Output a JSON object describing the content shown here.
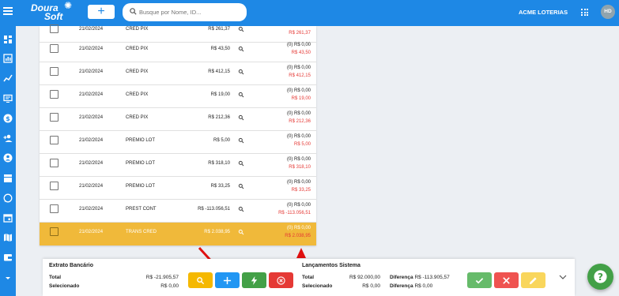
{
  "header": {
    "logo_line1": "Doura",
    "logo_line2": "Soft",
    "add_icon": "plus-icon",
    "search_placeholder": "Busque por Nome, ID...",
    "company": "ACME LOTERIAS",
    "avatar_initials": "HD"
  },
  "sidebar": {
    "icons": [
      "dashboard-icon",
      "bar-chart-icon",
      "trend-icon",
      "monitor-icon",
      "dollar-icon",
      "add-user-icon",
      "account-icon",
      "archive-icon",
      "whatsapp-icon",
      "calendar-icon",
      "map-icon",
      "wallet-icon",
      "chevron-down-icon"
    ]
  },
  "rows": [
    {
      "date": "21/02/2024",
      "desc": "CRED PIX",
      "value": "R$ 261,37",
      "info1": "",
      "info2": "R$ 261,37"
    },
    {
      "date": "21/02/2024",
      "desc": "CRED PIX",
      "value": "R$ 43,50",
      "info1": "(0) R$ 0,00",
      "info2": "R$ 43,50"
    },
    {
      "date": "21/02/2024",
      "desc": "CRED PIX",
      "value": "R$ 412,15",
      "info1": "(0) R$ 0,00",
      "info2": "R$ 412,15"
    },
    {
      "date": "21/02/2024",
      "desc": "CRED PIX",
      "value": "R$ 19,00",
      "info1": "(0) R$ 0,00",
      "info2": "R$ 19,00"
    },
    {
      "date": "21/02/2024",
      "desc": "CRED PIX",
      "value": "R$ 212,36",
      "info1": "(0) R$ 0,00",
      "info2": "R$ 212,36"
    },
    {
      "date": "21/02/2024",
      "desc": "PREMIO LOT",
      "value": "R$ 5,00",
      "info1": "(0) R$ 0,00",
      "info2": "R$ 5,00"
    },
    {
      "date": "21/02/2024",
      "desc": "PREMIO LOT",
      "value": "R$ 318,10",
      "info1": "(0) R$ 0,00",
      "info2": "R$ 318,10"
    },
    {
      "date": "21/02/2024",
      "desc": "PREMIO LOT",
      "value": "R$ 33,25",
      "info1": "(0) R$ 0,00",
      "info2": "R$ 33,25"
    },
    {
      "date": "21/02/2024",
      "desc": "PREST CONT",
      "value": "R$ -113.056,51",
      "info1": "(0) R$ 0,00",
      "info2": "R$ -113.056,51"
    },
    {
      "date": "21/02/2024",
      "desc": "TRANS CRED",
      "value": "R$ 2.038,95",
      "info1": "(0) R$ 0,00",
      "info2": "R$ 2.038,95"
    }
  ],
  "footer": {
    "left": {
      "title": "Extrato Bancário",
      "total_label": "Total",
      "total_value": "R$ -21.905,57",
      "selected_label": "Selecionado",
      "selected_value": "R$ 0,00"
    },
    "right": {
      "title": "Lançamentos Sistema",
      "total_label": "Total",
      "total_value": "R$ 92.000,00",
      "selected_label": "Selecionado",
      "selected_value": "R$ 0,00",
      "diff_label": "Diferença",
      "diff_value": "R$ -113.905,57",
      "diff2_label": "Diferença",
      "diff2_value": "R$ 0,00"
    }
  },
  "colors": {
    "primary": "#1e88e5",
    "highlight_row": "#f0b93a",
    "negative": "#e53935",
    "btn_yellow": "#f5b800",
    "btn_blue": "#2196f3",
    "btn_green": "#43a047",
    "btn_red": "#e53935",
    "btn_light_green": "#66bb6a",
    "btn_light_red": "#ef5350",
    "btn_light_yellow": "#f9d65c",
    "fab_green": "#43a047",
    "annotation_arrow": "#e01010"
  }
}
